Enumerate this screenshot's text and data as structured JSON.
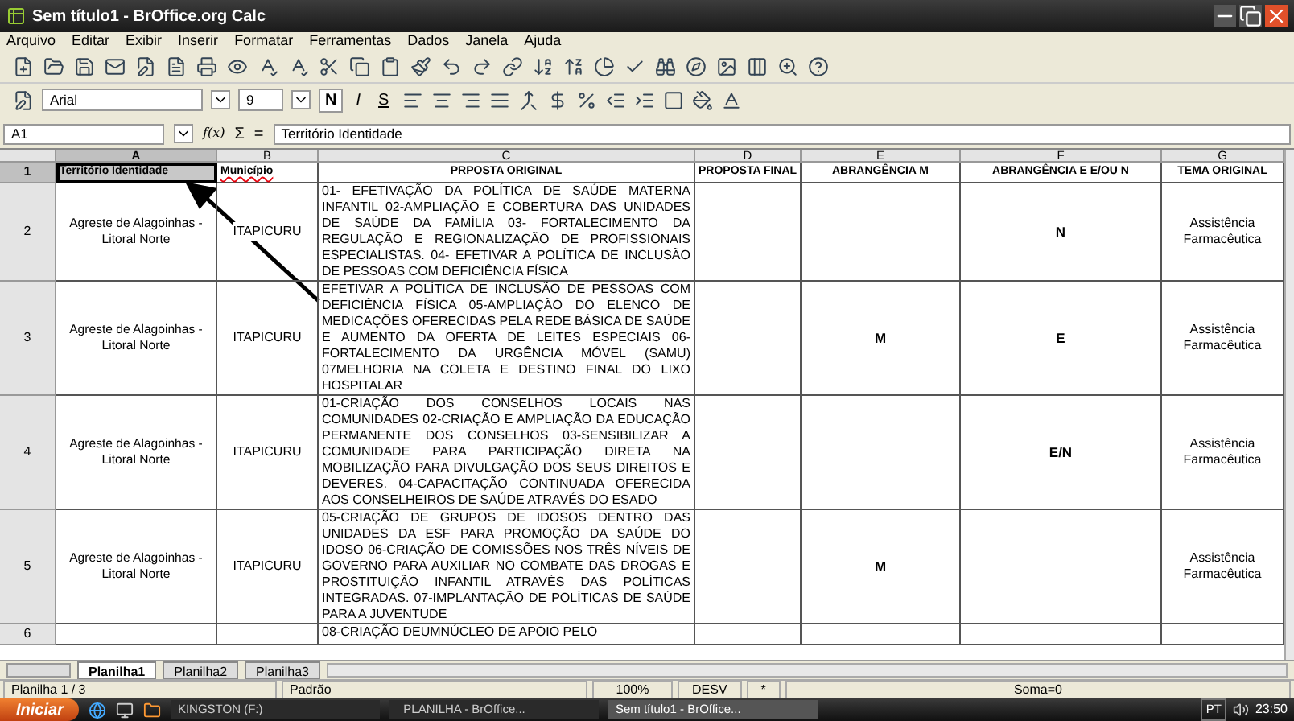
{
  "window": {
    "title": "Sem título1 - BrOffice.org Calc"
  },
  "menu": [
    "Arquivo",
    "Editar",
    "Exibir",
    "Inserir",
    "Formatar",
    "Ferramentas",
    "Dados",
    "Janela",
    "Ajuda"
  ],
  "format_bar": {
    "font": "Arial",
    "size": "9",
    "bold": "N",
    "italic": "I",
    "underline": "S"
  },
  "formula_bar": {
    "cell_ref": "A1",
    "function_wizard": "f(x)",
    "sum": "Σ",
    "equals": "=",
    "value": "Território Identidade"
  },
  "sheet": {
    "columns": [
      {
        "label": "A",
        "selected": true
      },
      {
        "label": "B",
        "selected": false
      },
      {
        "label": "C",
        "selected": false
      },
      {
        "label": "D",
        "selected": false
      },
      {
        "label": "E",
        "selected": false
      },
      {
        "label": "F",
        "selected": false
      },
      {
        "label": "G",
        "selected": false
      }
    ],
    "rows": [
      {
        "number": "1",
        "selected": true,
        "cells": [
          "Território Identidade",
          "Município",
          "PRPOSTA ORIGINAL",
          "PROPOSTA FINAL",
          "ABRANGÊNCIA M",
          "ABRANGÊNCIA E E/OU N",
          "TEMA ORIGINAL"
        ]
      },
      {
        "number": "2",
        "selected": false,
        "cells": [
          "Agreste de Alagoinhas - Litoral Norte",
          "ITAPICURU",
          "01- EFETIVAÇÃO DA POLÍTICA DE SAÚDE MATERNA INFANTIL 02-AMPLIAÇÃO E COBERTURA DAS UNIDADES DE SAÚDE DA FAMÍLIA 03- FORTALECIMENTO DA REGULAÇÃO E REGIONALIZAÇÃO DE PROFISSIONAIS ESPECIALISTAS. 04- EFETIVAR A POLÍTICA DE INCLUSÃO DE PESSOAS COM DEFICIÊNCIA FÍSICA",
          "",
          "",
          "N",
          "Assistência Farmacêutica"
        ]
      },
      {
        "number": "3",
        "selected": false,
        "cells": [
          "Agreste de Alagoinhas - Litoral Norte",
          "ITAPICURU",
          "EFETIVAR A POLÍTICA DE INCLUSÃO DE PESSOAS COM DEFICIÊNCIA FÍSICA 05-AMPLIAÇÃO DO ELENCO DE MEDICAÇÕES OFERECIDAS PELA REDE BÁSICA DE SAÚDE E AUMENTO DA OFERTA DE LEITES ESPECIAIS 06-FORTALECIMENTO DA URGÊNCIA MÓVEL (SAMU) 07MELHORIA NA COLETA E DESTINO FINAL DO LIXO HOSPITALAR",
          "",
          "M",
          "E",
          "Assistência Farmacêutica"
        ]
      },
      {
        "number": "4",
        "selected": false,
        "cells": [
          "Agreste de Alagoinhas - Litoral Norte",
          "ITAPICURU",
          "01-CRIAÇÃO DOS CONSELHOS LOCAIS NAS COMUNIDADES 02-CRIAÇÃO E AMPLIAÇÃO DA EDUCAÇÃO PERMANENTE DOS CONSELHOS 03-SENSIBILIZAR A COMUNIDADE PARA PARTICIPAÇÃO DIRETA NA MOBILIZAÇÃO PARA DIVULGAÇÃO DOS SEUS DIREITOS E DEVERES. 04-CAPACITAÇÃO CONTINUADA OFERECIDA AOS CONSELHEIROS DE SAÚDE ATRAVÉS DO ESADO",
          "",
          "",
          "E/N",
          "Assistência Farmacêutica"
        ]
      },
      {
        "number": "5",
        "selected": false,
        "cells": [
          "Agreste de Alagoinhas - Litoral Norte",
          "ITAPICURU",
          "05-CRIAÇÃO DE GRUPOS DE IDOSOS DENTRO DAS UNIDADES DA ESF PARA PROMOÇÃO DA SAÚDE DO IDOSO 06-CRIAÇÃO DE COMISSÕES NOS TRÊS NÍVEIS DE GOVERNO PARA AUXILIAR NO COMBATE DAS DROGAS E PROSTITUIÇÃO INFANTIL ATRAVÉS DAS POLÍTICAS INTEGRADAS. 07-IMPLANTAÇÃO DE POLÍTICAS DE SAÚDE PARA A JUVENTUDE",
          "",
          "M",
          "",
          "Assistência Farmacêutica"
        ]
      },
      {
        "number": "6",
        "selected": false,
        "cells": [
          "",
          "",
          "08-CRIAÇÃO DEUMNÚCLEO DE APOIO PELO",
          "",
          "",
          "",
          ""
        ]
      }
    ]
  },
  "sheet_tabs": [
    {
      "label": "Planilha1",
      "selected": true
    },
    {
      "label": "Planilha2",
      "selected": false
    },
    {
      "label": "Planilha3",
      "selected": false
    }
  ],
  "status_bar": [
    "Planilha 1 / 3",
    "Padrão",
    "100%",
    "DESV",
    "*",
    "Soma=0"
  ],
  "taskbar": {
    "start": "Iniciar",
    "items": [
      {
        "label": "KINGSTON (F:)",
        "selected": false
      },
      {
        "label": "_PLANILHA - BrOffice...",
        "selected": false
      },
      {
        "label": "Sem título1 - BrOffice...",
        "selected": true
      }
    ],
    "language": "PT",
    "clock": "23:50"
  }
}
